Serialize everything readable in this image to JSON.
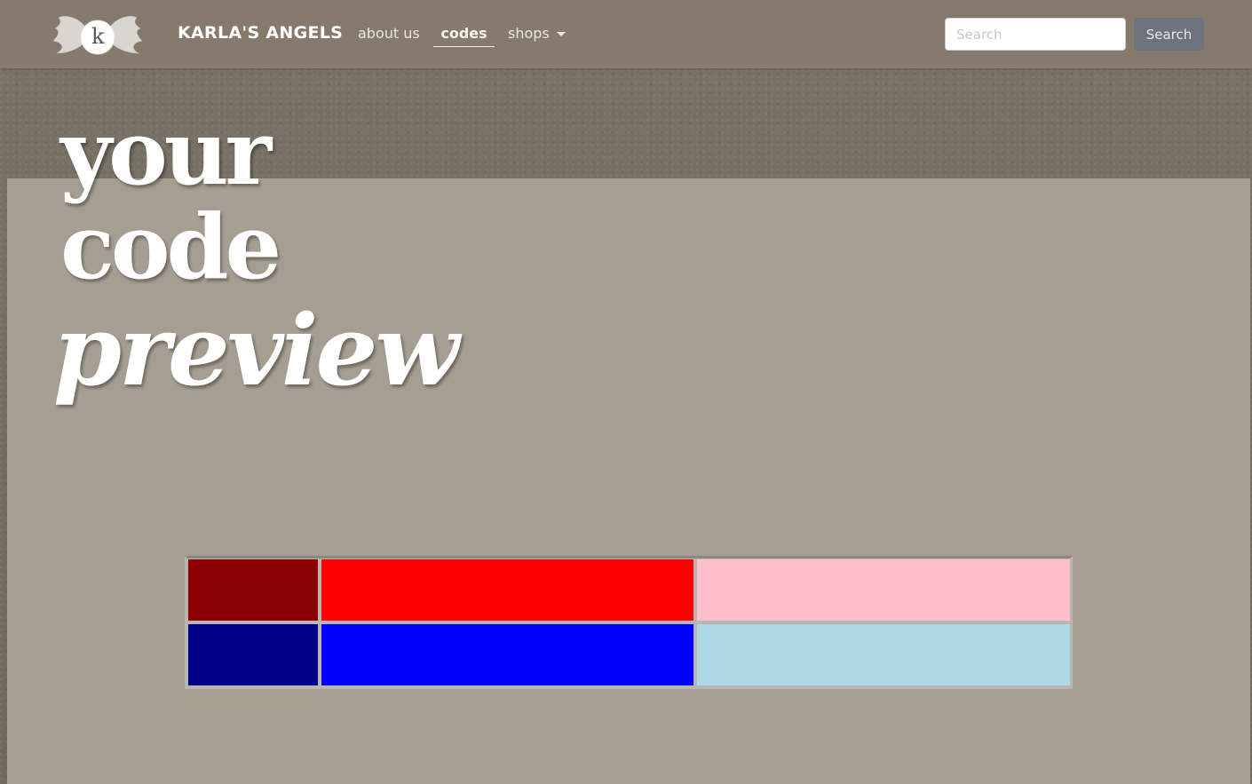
{
  "navbar": {
    "brand": "KARLA'S ANGELS",
    "logo_letter": "k",
    "links": {
      "about": "about us",
      "codes": "codes",
      "shops": "shops"
    },
    "search": {
      "placeholder": "Search",
      "button_label": "Search"
    }
  },
  "hero": {
    "line1": "your",
    "line2": "code",
    "line3": "preview"
  },
  "palette": {
    "rows": [
      [
        "#8b0000",
        "#ff0000",
        "#ffc0cb"
      ],
      [
        "#00008b",
        "#0000ff",
        "#add8e6"
      ]
    ]
  },
  "colors": {
    "navbar_bg": "#857a6b",
    "panel_bg": "#a69e90",
    "search_button_bg": "#6c737b"
  }
}
